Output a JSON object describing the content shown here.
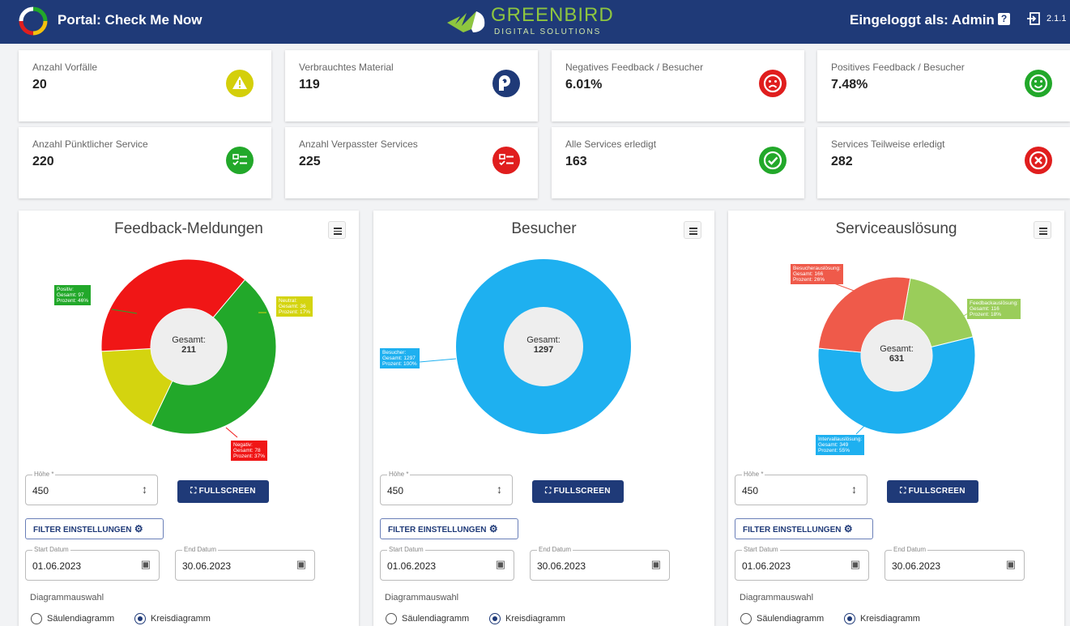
{
  "header": {
    "title": "Portal: Check Me Now",
    "brand_name": "GREENBIRD",
    "brand_sub": "DIGITAL SOLUTIONS",
    "login_text": "Eingeloggt als: Admin",
    "help_icon": "?",
    "version": "2.1.1"
  },
  "kpis": [
    {
      "label": "Anzahl Vorfälle",
      "value": "20",
      "icon": "warning-icon",
      "color": "#d4cf0a"
    },
    {
      "label": "Verbrauchtes Material",
      "value": "119",
      "icon": "toilet-paper-icon",
      "color": "#1f3a78"
    },
    {
      "label": "Negatives Feedback / Besucher",
      "value": "6.01%",
      "icon": "sad-face-icon",
      "color": "#e01e1e"
    },
    {
      "label": "Positives Feedback / Besucher",
      "value": "7.48%",
      "icon": "happy-face-icon",
      "color": "#22a82a"
    },
    {
      "label": "Anzahl Pünktlicher Service",
      "value": "220",
      "icon": "checklist-icon",
      "color": "#22a82a"
    },
    {
      "label": "Anzahl Verpasster Services",
      "value": "225",
      "icon": "checklist-icon",
      "color": "#e01e1e"
    },
    {
      "label": "Alle Services erledigt",
      "value": "163",
      "icon": "check-circle-icon",
      "color": "#22a82a"
    },
    {
      "label": "Services Teilweise erledigt",
      "value": "282",
      "icon": "x-circle-icon",
      "color": "#e01e1e"
    }
  ],
  "controls": {
    "height_label": "Höhe *",
    "height_value": "450",
    "fullscreen_label": "FULLSCREEN",
    "filter_label": "FILTER EINSTELLUNGEN",
    "start_label": "Start Datum",
    "start_value": "01.06.2023",
    "end_label": "End Datum",
    "end_value": "30.06.2023",
    "diagram_label": "Diagrammauswahl",
    "option_bar": "Säulendiagramm",
    "option_pie": "Kreisdiagramm",
    "selected": "Kreisdiagramm"
  },
  "chart_data": [
    {
      "type": "pie",
      "title": "Feedback-Meldungen",
      "center_label": "Gesamt:",
      "total": "211",
      "slices": [
        {
          "name": "Positiv",
          "value": 97,
          "percent": 46,
          "color": "#22a82a",
          "label_lines": [
            "Positiv:",
            "Gesamt: 97",
            "Prozent: 46%"
          ]
        },
        {
          "name": "Neutral",
          "value": 36,
          "percent": 17,
          "color": "#d4d40f",
          "label_lines": [
            "Neutral:",
            "Gesamt: 36",
            "Prozent: 17%"
          ]
        },
        {
          "name": "Negativ",
          "value": 78,
          "percent": 37,
          "color": "#f01616",
          "label_lines": [
            "Negativ:",
            "Gesamt: 78",
            "Prozent: 37%"
          ]
        }
      ]
    },
    {
      "type": "pie",
      "title": "Besucher",
      "center_label": "Gesamt:",
      "total": "1297",
      "slices": [
        {
          "name": "Besucher",
          "value": 1297,
          "percent": 100,
          "color": "#1eb0f0",
          "label_lines": [
            "Besucher:",
            "Gesamt: 1297",
            "Prozent: 100%"
          ]
        }
      ]
    },
    {
      "type": "pie",
      "title": "Serviceauslösung",
      "center_label": "Gesamt:",
      "total": "631",
      "slices": [
        {
          "name": "Feedbackauslösung",
          "value": 116,
          "percent": 18,
          "color": "#9acd5a",
          "label_lines": [
            "Feedbackauslösung:",
            "Gesamt: 116",
            "Prozent: 18%"
          ]
        },
        {
          "name": "Intervallauslösung",
          "value": 349,
          "percent": 55,
          "color": "#1eb0f0",
          "label_lines": [
            "Intervallauslösung:",
            "Gesamt: 349",
            "Prozent: 55%"
          ]
        },
        {
          "name": "Besucherauslösung",
          "value": 166,
          "percent": 26,
          "color": "#ef5a4a",
          "label_lines": [
            "Besucherauslösung:",
            "Gesamt: 166",
            "Prozent: 26%"
          ]
        }
      ]
    }
  ]
}
